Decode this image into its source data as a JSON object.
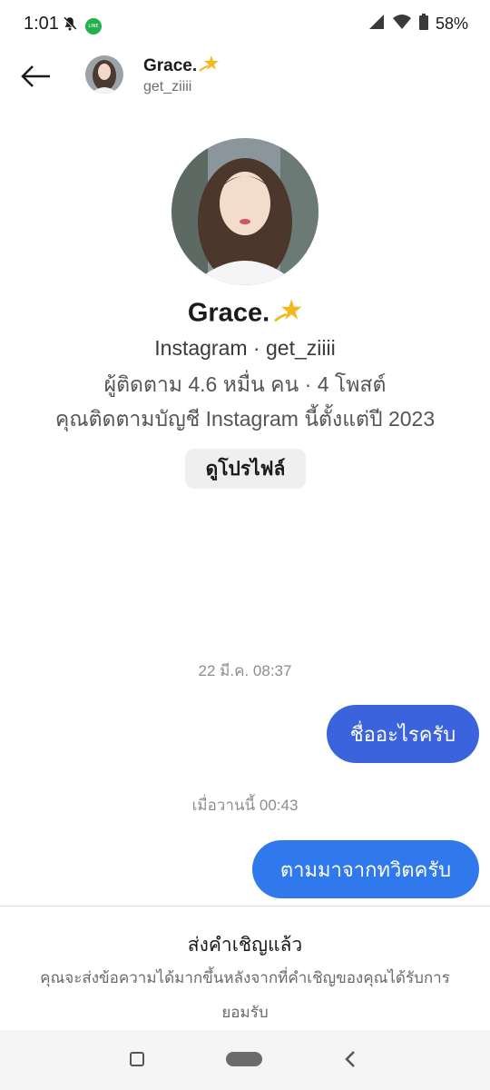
{
  "status": {
    "time": "1:01",
    "battery": "58%",
    "icons": [
      "mute-bell-icon",
      "line-app-icon",
      "signal-icon",
      "wifi-icon",
      "battery-icon"
    ],
    "line_badge": "LINE"
  },
  "header": {
    "name": "Grace.",
    "name_emoji": "💫",
    "username": "get_ziiii"
  },
  "profile": {
    "name": "Grace.",
    "name_emoji": "💫",
    "line1": "Instagram · get_ziiii",
    "line2": "ผู้ติดตาม 4.6 หมื่น คน · 4 โพสต์",
    "line3": "คุณติดตามบัญชี Instagram นี้ตั้งแต่ปี 2023",
    "view_profile_label": "ดูโปรไฟล์"
  },
  "messages": [
    {
      "timestamp": "22 มี.ค. 08:37",
      "text": "ชื่ออะไรครับ",
      "color": "#3b63dd"
    },
    {
      "timestamp": "เมื่อวานนี้ 00:43",
      "text": "ตามมาจากทวิตครับ",
      "color": "#2f79ec"
    }
  ],
  "invite": {
    "title": "ส่งคำเชิญแล้ว",
    "description": "คุณจะส่งข้อความได้มากขึ้นหลังจากที่คำเชิญของคุณได้รับการยอมรับ"
  },
  "colors": {
    "accent": "#3b63dd",
    "button_bg": "#efefef"
  }
}
